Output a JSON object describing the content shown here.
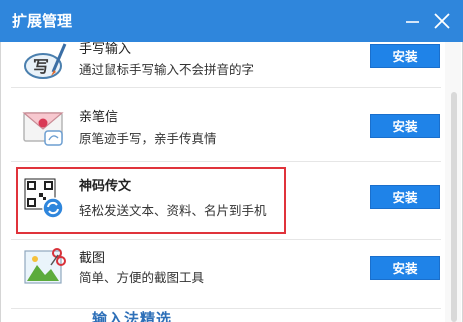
{
  "window": {
    "title": "扩展管理",
    "accent": "#2f86dc",
    "highlight_color": "#e0333b"
  },
  "titlebar_icons": [
    "minimize-icon",
    "close-icon"
  ],
  "extensions": [
    {
      "name": "手写输入",
      "desc": "通过鼠标手写输入不会拼音的字",
      "action": "安装",
      "icon": "handwriting-icon"
    },
    {
      "name": "亲笔信",
      "desc": "原笔迹手写，亲手传真情",
      "action": "安装",
      "icon": "envelope-icon"
    },
    {
      "name": "神码传文",
      "desc": "轻松发送文本、资料、名片到手机",
      "action": "安装",
      "icon": "qr-code-icon"
    },
    {
      "name": "截图",
      "desc": "简单、方便的截图工具",
      "action": "安装",
      "icon": "screenshot-icon"
    }
  ],
  "peek": {
    "text": "输入法精选"
  }
}
